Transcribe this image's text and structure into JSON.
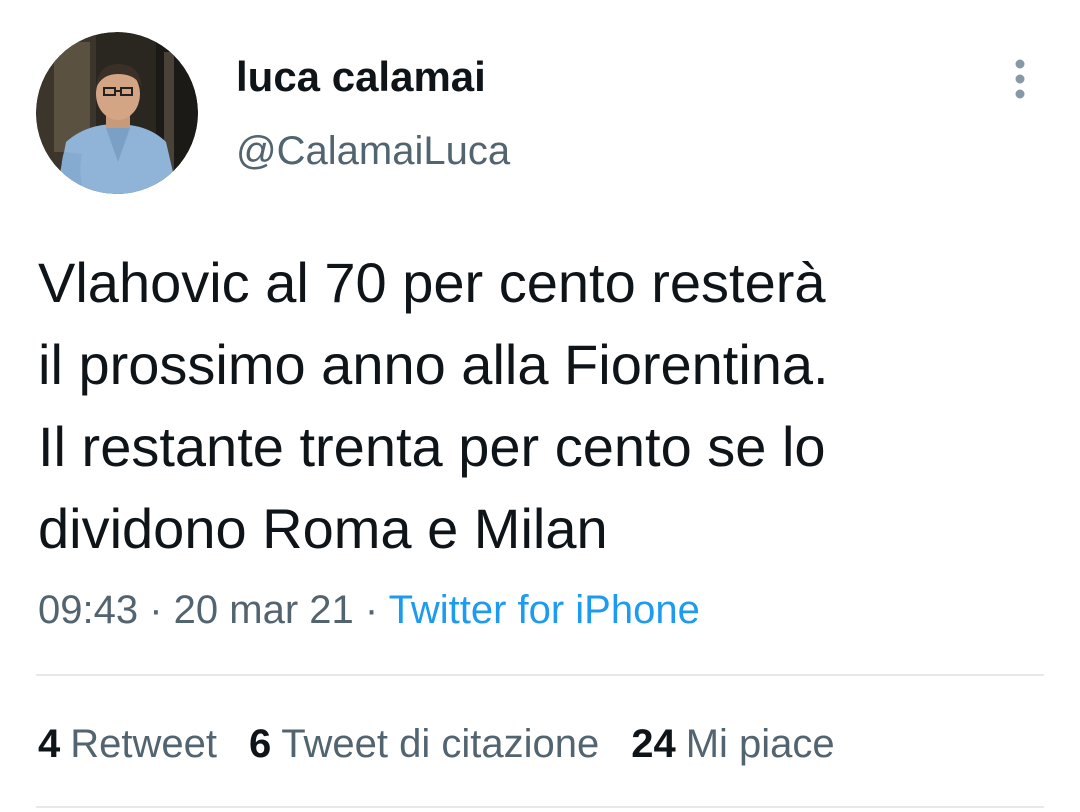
{
  "tweet": {
    "author": {
      "display_name": "luca calamai",
      "handle": "@CalamaiLuca"
    },
    "text_lines": [
      "Vlahovic al 70 per cento resterà",
      "il prossimo anno alla Fiorentina.",
      "Il restante trenta per cento se lo",
      "dividono Roma e Milan"
    ],
    "time": "09:43",
    "separator": " · ",
    "date": "20 mar 21",
    "source": "Twitter for iPhone",
    "stats": {
      "retweets": {
        "count": "4",
        "label": "Retweet"
      },
      "quotes": {
        "count": "6",
        "label": "Tweet di citazione"
      },
      "likes": {
        "count": "24",
        "label": "Mi piace"
      }
    }
  },
  "icons": {
    "more": "more-vertical-icon"
  },
  "colors": {
    "text_primary": "#0f1419",
    "text_secondary": "#536471",
    "link": "#1d9bf0",
    "divider": "#e6e9ec"
  }
}
